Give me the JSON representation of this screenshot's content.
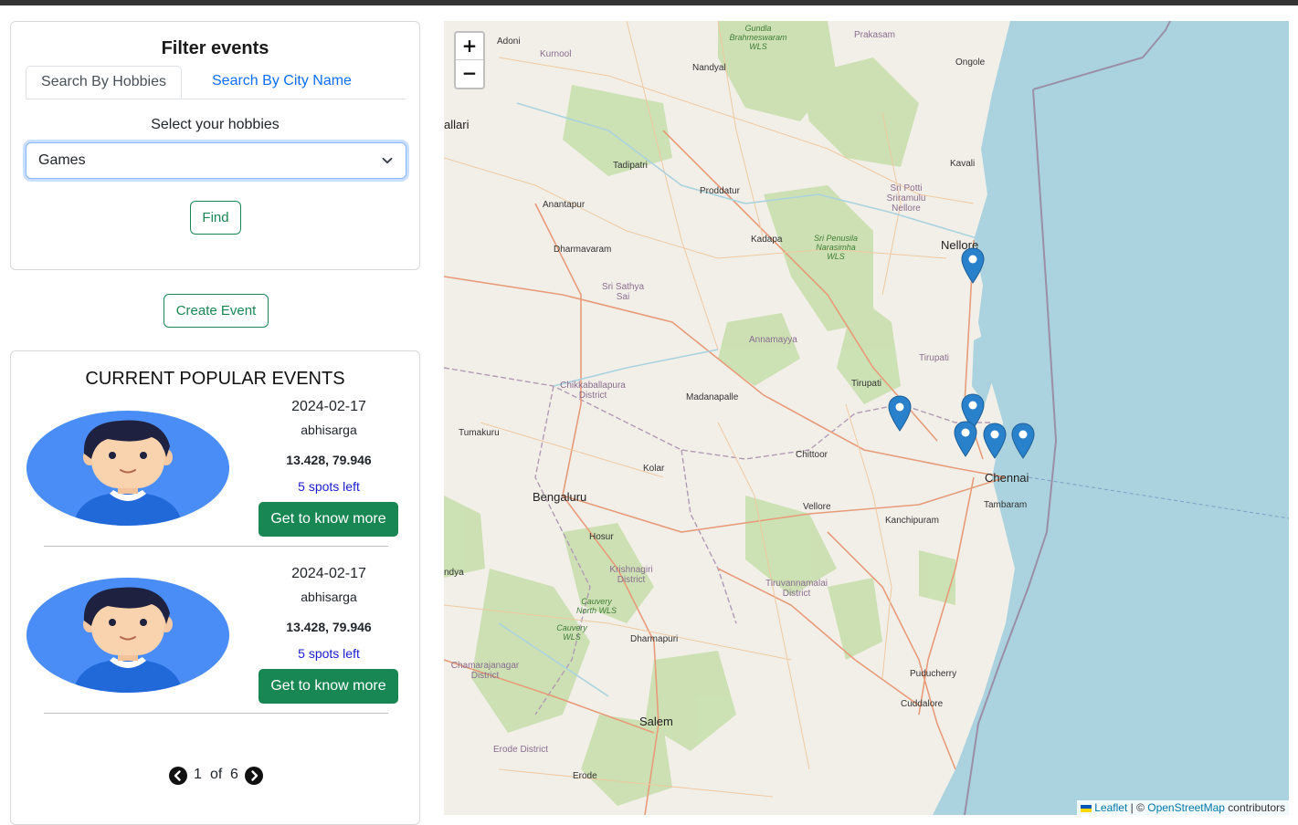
{
  "filter": {
    "title": "Filter events",
    "tabs": [
      {
        "label": "Search By Hobbies",
        "active": true
      },
      {
        "label": "Search By City Name",
        "active": false
      }
    ],
    "select_label": "Select your hobbies",
    "selected_hobby": "Games",
    "find_label": "Find"
  },
  "create_event_label": "Create Event",
  "popular": {
    "title": "CURRENT POPULAR EVENTS",
    "events": [
      {
        "date": "2024-02-17",
        "user": "abhisarga",
        "coords": "13.428, 79.946",
        "spots": "5 spots left",
        "button": "Get to know more"
      },
      {
        "date": "2024-02-17",
        "user": "abhisarga",
        "coords": "13.428, 79.946",
        "spots": "5 spots left",
        "button": "Get to know more"
      }
    ],
    "pagination": {
      "current": "1",
      "of": "of",
      "total": "6"
    }
  },
  "map": {
    "zoom_in": "+",
    "zoom_out": "−",
    "attribution": {
      "leaflet": "Leaflet",
      "separator": " | © ",
      "osm": "OpenStreetMap",
      "contributors": " contributors"
    },
    "cities": {
      "adoni": "Adoni",
      "kurnool": "Kurnool",
      "nandyal": "Nandyal",
      "prakasam": "Prakasam",
      "ongole": "Ongole",
      "ballari": "allari",
      "tadipatri": "Tadipatri",
      "proddatur": "Proddatur",
      "kavali": "Kavali",
      "anantapur": "Anantapur",
      "dharmavaram": "Dharmavaram",
      "kadapa": "Kadapa",
      "nellore": "Nellore",
      "sri_potti": "Sri Potti Sriramulu Nellore",
      "sri_sathya": "Sri Sathya Sai",
      "annamayya": "Annamayya",
      "tirupati_dist": "Tirupati",
      "tirupati": "Tirupati",
      "chikkaballapura": "Chikkaballapura District",
      "madanapalle": "Madanapalle",
      "tumakuru": "Tumakuru",
      "chittoor": "Chittoor",
      "kolar": "Kolar",
      "chennai": "Chennai",
      "bengaluru": "Bengaluru",
      "vellore": "Vellore",
      "tambaram": "Tambaram",
      "kanchipuram": "Kanchipuram",
      "hosur": "Hosur",
      "ndya": "ndya",
      "krishnagiri": "Krishnagiri District",
      "tiruvannamalai": "Tiruvannamalai District",
      "dharmapuri": "Dharmapuri",
      "chamarajanagar": "Chamarajanagar District",
      "puducherry": "Puducherry",
      "cuddalore": "Cuddalore",
      "salem": "Salem",
      "erode_dist": "Erode District",
      "erode": "Erode"
    },
    "wildlife": {
      "gundla": "Gundla Brahmeswaram WLS",
      "penusila": "Sri Penusila Narasimha WLS",
      "cauvery_north": "Cauvery North WLS",
      "cauvery": "Cauvery WLS"
    },
    "markers": 6,
    "colors": {
      "water": "#aad3df",
      "land": "#f2efe9",
      "forest": "#c8dfae",
      "marker": "#2a81cb"
    }
  }
}
